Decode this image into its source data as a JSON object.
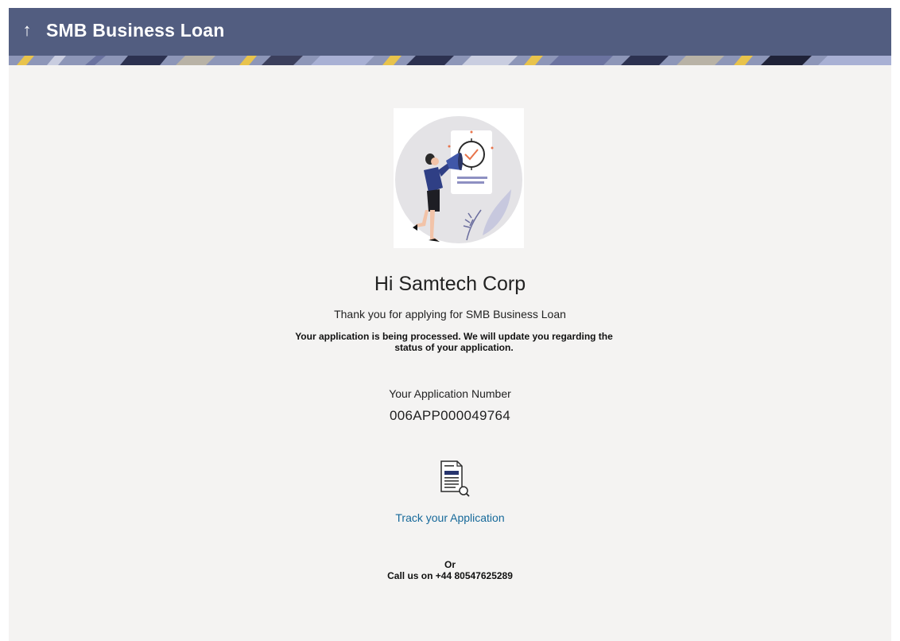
{
  "header": {
    "back_icon": "arrow-up-icon",
    "back_glyph": "↑",
    "title": "SMB Business Loan",
    "background_color": "#525d80"
  },
  "illustration": {
    "icon": "woman-with-megaphone-illustration"
  },
  "main": {
    "greeting": "Hi Samtech Corp",
    "thanks_message": "Thank you for applying for SMB Business Loan",
    "processing_message": "Your application is being processed. We will update you regarding the status of your application.",
    "application_number_label": "Your Application Number",
    "application_number": "006APP000049764",
    "track_icon": "document-search-icon",
    "track_link": "Track your Application",
    "or_text": "Or",
    "call_text": "Call us on +44 80547625289",
    "link_color": "#16699a"
  }
}
